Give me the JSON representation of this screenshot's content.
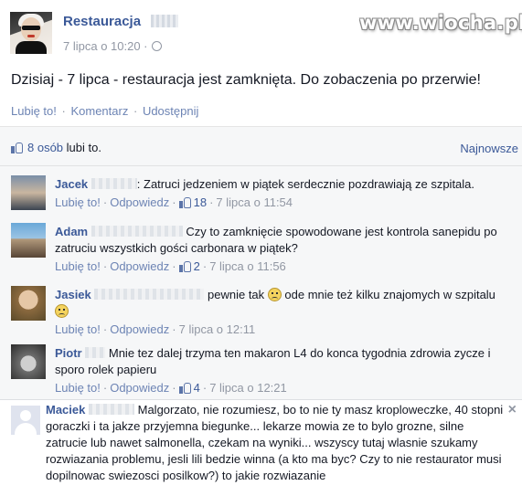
{
  "post": {
    "page_name": "Restauracja",
    "date": "7 lipca o 10:20 ·",
    "text": "Dzisiaj - 7 lipca - restauracja jest zamknięta. Do zobaczenia po przerwie!",
    "actions": {
      "like": "Lubię to!",
      "comment": "Komentarz",
      "share": "Udostępnij",
      "sep": "·"
    }
  },
  "watermark": "www.wiocha.pl",
  "likes": {
    "count_text": "8 osób",
    "suffix": "lubi to.",
    "sort_label": "Najnowsze"
  },
  "comments": [
    {
      "author": "Jacek",
      "text": ": Zatruci jedzeniem w piątek serdecznie pozdrawiają ze szpitala.",
      "like": "Lubię to!",
      "reply": "Odpowiedz",
      "likes": "18",
      "time": "7 lipca o 11:54",
      "sep": "·"
    },
    {
      "author": "Adam",
      "text": "Czy to zamknięcie spowodowane jest kontrola sanepidu po zatruciu wszystkich gości carbonara w piątek?",
      "like": "Lubię to!",
      "reply": "Odpowiedz",
      "likes": "2",
      "time": "7 lipca o 11:56",
      "sep": "·"
    },
    {
      "author": "Jasiek",
      "text_a": "pewnie tak",
      "text_b": "ode mnie też kilku znajomych w szpitalu",
      "like": "Lubię to!",
      "reply": "Odpowiedz",
      "time": "7 lipca o 12:11",
      "sep": "·"
    },
    {
      "author": "Piotr",
      "text": "Mnie tez dalej trzyma ten makaron L4 do konca tygodnia zdrowia zycze i sporo rolek papieru",
      "like": "Lubię to!",
      "reply": "Odpowiedz",
      "likes": "4",
      "time": "7 lipca o 12:21",
      "sep": "·"
    },
    {
      "author": "Maciek",
      "text": "Malgorzato, nie rozumiesz, bo to nie ty masz kroploweczke, 40 stopni goraczki i ta jakze przyjemna biegunke... lekarze mowia ze to bylo grozne, silne zatrucie lub nawet salmonella, czekam na wyniki... wszyscy tutaj wlasnie szukamy rozwiazania problemu, jesli lili bedzie winna (a kto ma byc? Czy to nie restaurator musi dopilnowac swiezosci posilkow?) to jakie rozwiazanie",
      "close": "×"
    }
  ]
}
